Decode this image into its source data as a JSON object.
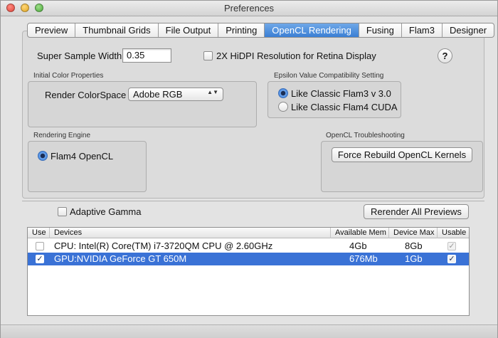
{
  "window": {
    "title": "Preferences"
  },
  "tabs": [
    {
      "label": "Preview",
      "active": false
    },
    {
      "label": "Thumbnail Grids",
      "active": false
    },
    {
      "label": "File Output",
      "active": false
    },
    {
      "label": "Printing",
      "active": false
    },
    {
      "label": "OpenCL Rendering",
      "active": true
    },
    {
      "label": "Fusing",
      "active": false
    },
    {
      "label": "Flam3",
      "active": false
    },
    {
      "label": "Designer",
      "active": false
    }
  ],
  "super_sample": {
    "label": "Super Sample Width",
    "value": "0.35"
  },
  "hidpi": {
    "label": "2X HiDPI Resolution for Retina Display",
    "checked": false
  },
  "help": {
    "label": "?"
  },
  "initial_color": {
    "group_label": "Initial Color Properties",
    "render_colorspace_label": "Render ColorSpace",
    "render_colorspace_value": "Adobe RGB",
    "popup_arrows": "▲▼"
  },
  "epsilon": {
    "group_label": "Epsilon Value Compatibility Setting",
    "options": [
      {
        "label": "Like Classic Flam3 v 3.0",
        "selected": true
      },
      {
        "label": "Like Classic Flam4 CUDA",
        "selected": false
      }
    ]
  },
  "rendering_engine": {
    "group_label": "Rendering Engine",
    "option": {
      "label": "Flam4 OpenCL",
      "selected": true
    }
  },
  "troubleshooting": {
    "group_label": "OpenCL Troubleshooting",
    "button_label": "Force Rebuild OpenCL Kernels"
  },
  "adaptive_gamma": {
    "label": "Adaptive Gamma",
    "checked": false
  },
  "rerender_button": {
    "label": "Rerender All Previews"
  },
  "devices_table": {
    "columns": [
      "Use",
      "Devices",
      "Available Mem",
      "Device Max",
      "Usable"
    ],
    "rows": [
      {
        "use": false,
        "device": "CPU: Intel(R) Core(TM) i7-3720QM CPU @ 2.60GHz",
        "available_mem": "4Gb",
        "device_max": "8Gb",
        "usable": true,
        "selected": false
      },
      {
        "use": true,
        "device": "GPU:NVIDIA GeForce GT 650M",
        "available_mem": "676Mb",
        "device_max": "1Gb",
        "usable": true,
        "selected": true
      }
    ],
    "check_glyph": "✓"
  }
}
